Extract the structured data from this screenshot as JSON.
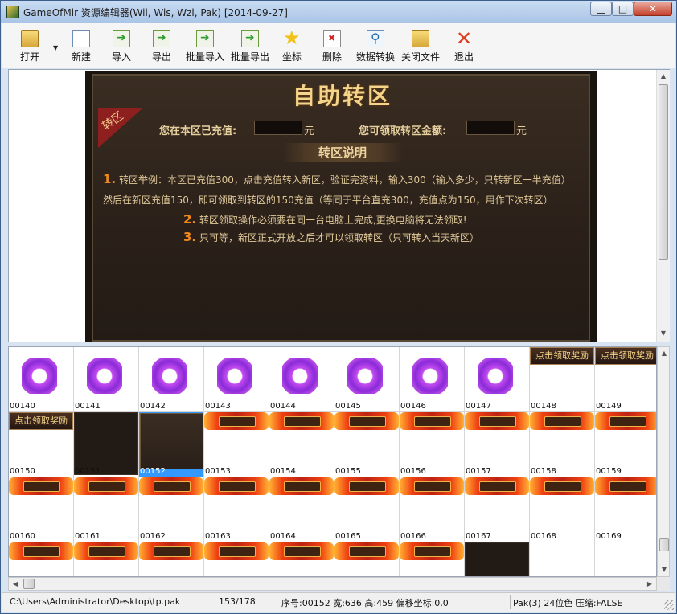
{
  "window": {
    "title": "GameOfMir 资源编辑器(Wil, Wis, Wzl, Pak) [2014-09-27]",
    "min_label": "▁",
    "max_label": "□",
    "close_label": "✕"
  },
  "toolbar": {
    "items": [
      {
        "label": "打开",
        "icon": "folder-open-icon"
      },
      {
        "label": "新建",
        "icon": "new-file-icon"
      },
      {
        "label": "导入",
        "icon": "import-icon"
      },
      {
        "label": "导出",
        "icon": "export-icon"
      },
      {
        "label": "批量导入",
        "icon": "batch-import-icon"
      },
      {
        "label": "批量导出",
        "icon": "batch-export-icon"
      },
      {
        "label": "坐标",
        "icon": "star-icon"
      },
      {
        "label": "删除",
        "icon": "delete-icon"
      },
      {
        "label": "数据转换",
        "icon": "search-icon"
      },
      {
        "label": "关闭文件",
        "icon": "close-file-icon"
      },
      {
        "label": "退出",
        "icon": "exit-icon"
      }
    ]
  },
  "preview": {
    "title": "自助转区",
    "ribbon": "转区",
    "recharged_label": "您在本区已充值:",
    "recharged_unit": "元",
    "claim_label": "您可领取转区金额:",
    "claim_unit": "元",
    "section_title": "转区说明",
    "line1_num": "1.",
    "line1": "转区举例：本区已充值300，点击充值转入新区，验证完资料，输入300（输入多少，只转新区一半充值）",
    "line1b": "然后在新区充值150，即可领取到转区的150充值（等同于平台直充300，充值点为150，用作下次转区）",
    "line2_num": "2.",
    "line2": "转区领取操作必须要在同一台电脑上完成,更换电脑将无法领取!",
    "line3_num": "3.",
    "line3": "只可等，新区正式开放之后才可以领取转区（只可转入当天新区）"
  },
  "grid": {
    "cells": [
      {
        "label": "00140",
        "kind": "purple"
      },
      {
        "label": "00141",
        "kind": "purple"
      },
      {
        "label": "00142",
        "kind": "purple"
      },
      {
        "label": "00143",
        "kind": "purple"
      },
      {
        "label": "00144",
        "kind": "purple"
      },
      {
        "label": "00145",
        "kind": "purple"
      },
      {
        "label": "00146",
        "kind": "purple"
      },
      {
        "label": "00147",
        "kind": "purple"
      },
      {
        "label": "00148",
        "kind": "button",
        "text": "点击领取奖励"
      },
      {
        "label": "00149",
        "kind": "button",
        "text": "点击领取奖励"
      },
      {
        "label": "00150",
        "kind": "button",
        "text": "点击领取奖励"
      },
      {
        "label": "00151",
        "kind": "dark"
      },
      {
        "label": "00152",
        "kind": "panel",
        "selected": true
      },
      {
        "label": "00153",
        "kind": "flame"
      },
      {
        "label": "00154",
        "kind": "flame"
      },
      {
        "label": "00155",
        "kind": "flame"
      },
      {
        "label": "00156",
        "kind": "flame"
      },
      {
        "label": "00157",
        "kind": "flame"
      },
      {
        "label": "00158",
        "kind": "flame"
      },
      {
        "label": "00159",
        "kind": "flame"
      },
      {
        "label": "00160",
        "kind": "flame"
      },
      {
        "label": "00161",
        "kind": "flame"
      },
      {
        "label": "00162",
        "kind": "flame"
      },
      {
        "label": "00163",
        "kind": "flame"
      },
      {
        "label": "00164",
        "kind": "flame"
      },
      {
        "label": "00165",
        "kind": "flame"
      },
      {
        "label": "00166",
        "kind": "flame"
      },
      {
        "label": "00167",
        "kind": "flame"
      },
      {
        "label": "00168",
        "kind": "flame"
      },
      {
        "label": "00169",
        "kind": "flame"
      },
      {
        "label": "",
        "kind": "flame"
      },
      {
        "label": "",
        "kind": "flame"
      },
      {
        "label": "",
        "kind": "flame"
      },
      {
        "label": "",
        "kind": "flame"
      },
      {
        "label": "",
        "kind": "flame"
      },
      {
        "label": "",
        "kind": "flame"
      },
      {
        "label": "",
        "kind": "flame"
      },
      {
        "label": "",
        "kind": "dark"
      },
      {
        "label": "",
        "kind": "empty"
      },
      {
        "label": "",
        "kind": "empty"
      }
    ]
  },
  "status": {
    "path": "C:\\Users\\Administrator\\Desktop\\tp.pak",
    "count": "153/178",
    "info": "序号:00152 宽:636 高:459 偏移坐标:0,0",
    "format": "Pak(3) 24位色 压缩:FALSE"
  },
  "colors": {
    "selection": "#3399ff",
    "accent_orange": "#f08a1c",
    "title_gold": "#f3d48a"
  }
}
